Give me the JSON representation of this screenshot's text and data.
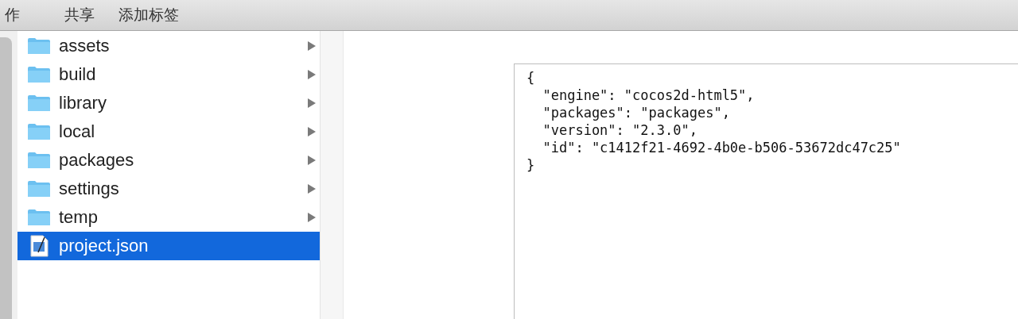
{
  "toolbar": {
    "items": [
      "作",
      "共享",
      "添加标签"
    ]
  },
  "files": [
    {
      "name": "assets",
      "kind": "folder",
      "selected": false
    },
    {
      "name": "build",
      "kind": "folder",
      "selected": false
    },
    {
      "name": "library",
      "kind": "folder",
      "selected": false
    },
    {
      "name": "local",
      "kind": "folder",
      "selected": false
    },
    {
      "name": "packages",
      "kind": "folder",
      "selected": false
    },
    {
      "name": "settings",
      "kind": "folder",
      "selected": false
    },
    {
      "name": "temp",
      "kind": "folder",
      "selected": false
    },
    {
      "name": "project.json",
      "kind": "file",
      "selected": true
    }
  ],
  "preview": {
    "lines": [
      "{",
      "  \"engine\": \"cocos2d-html5\",",
      "  \"packages\": \"packages\",",
      "  \"version\": \"2.3.0\",",
      "  \"id\": \"c1412f21-4692-4b0e-b506-53672dc47c25\"",
      "}"
    ]
  }
}
